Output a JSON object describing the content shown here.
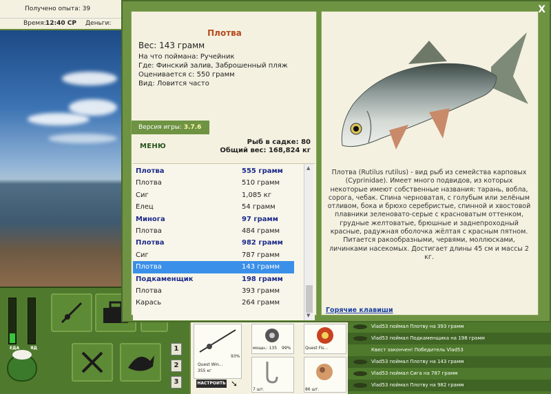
{
  "status": {
    "experience": "Получено опыта: 39",
    "time_label": "Время:",
    "time_value": "12:40 СР",
    "money_label": "Деньги:"
  },
  "left_panel": {
    "gauge_food": "ЕДА",
    "gauge_poison": "ЯД",
    "buttons": [
      "1",
      "2",
      "3"
    ]
  },
  "gear": {
    "rod_label": "Quest Win...",
    "rod_weight": "355 кг",
    "rod_percent": "93%",
    "reel_label": "мощн.: 135",
    "reel_percent": "99%",
    "line_label": "Quest Fis...",
    "hook_count": "7 шт.",
    "bait_count": "86 шт.",
    "setup_button": "НАСТРОИТЬ"
  },
  "log": [
    "Vlad53 поймал Плотву на 393 грамм",
    "Vlad53 поймал Подкаменщика на 198 грамм",
    "Квест закончен! Победитель Vlad53",
    "Vlad53 поймал Плотву на 143 грамм",
    "Vlad53 поймал Сига на 787 грамм",
    "Vlad53 поймал Плотву на 982 грамм"
  ],
  "dialog": {
    "close": "X",
    "fish_name": "Плотва",
    "weight": "Вес: 143 грамм",
    "caught_on": "На что поймана: Ручейник",
    "where": "Где: Финский залив, Заброшенный пляж",
    "value": "Оценивается с: 550 грамм",
    "kind": "Вид: Ловится часто",
    "version_label": "Версия игры:",
    "version_value": "3.7.6",
    "menu": "МЕНЮ",
    "cage_count": "Рыб в садке: 80",
    "total_weight": "Общий вес: 168,824 кг",
    "catch_list": [
      {
        "name": "Плотва",
        "weight": "555 грамм",
        "bold": true
      },
      {
        "name": "Плотва",
        "weight": "510 грамм",
        "bold": false
      },
      {
        "name": "Сиг",
        "weight": "1,085 кг",
        "bold": false
      },
      {
        "name": "Елец",
        "weight": "54 грамм",
        "bold": false
      },
      {
        "name": "Минога",
        "weight": "97 грамм",
        "bold": true
      },
      {
        "name": "Плотва",
        "weight": "484 грамм",
        "bold": false
      },
      {
        "name": "Плотва",
        "weight": "982 грамм",
        "bold": true
      },
      {
        "name": "Сиг",
        "weight": "787 грамм",
        "bold": false
      },
      {
        "name": "Плотва",
        "weight": "143 грамм",
        "bold": false,
        "selected": true
      },
      {
        "name": "Подкаменщик",
        "weight": "198 грамм",
        "bold": true
      },
      {
        "name": "Плотва",
        "weight": "393 грамм",
        "bold": false
      },
      {
        "name": "Карась",
        "weight": "264 грамм",
        "bold": false
      }
    ],
    "description": "Плотва (Rutilus rutilus) - вид рыб из семейства карповых (Cyprinidae). Имеет много подвидов, из которых некоторые имеют собственные названия: тарань, вобла, сорога, чебак. Спина черноватая, с голубым или зелёным отливом, бока и брюхо серебристые, спинной и хвостовой плавники зеленовато-серые с красноватым оттенком, грудные желтоватые, брюшные и заднепроходный красные, радужная оболочка жёлтая с красным пятном. Питается ракообразными, червями, моллюсками, личинками насекомых. Достигает длины 45 см и массы 2 кг.",
    "hotkeys": "Горячие клавиши"
  },
  "colors": {
    "panel_green": "#6e9343",
    "cream": "#f4f1e1",
    "select_blue": "#3a8fe8",
    "title_orange": "#b6491a"
  }
}
